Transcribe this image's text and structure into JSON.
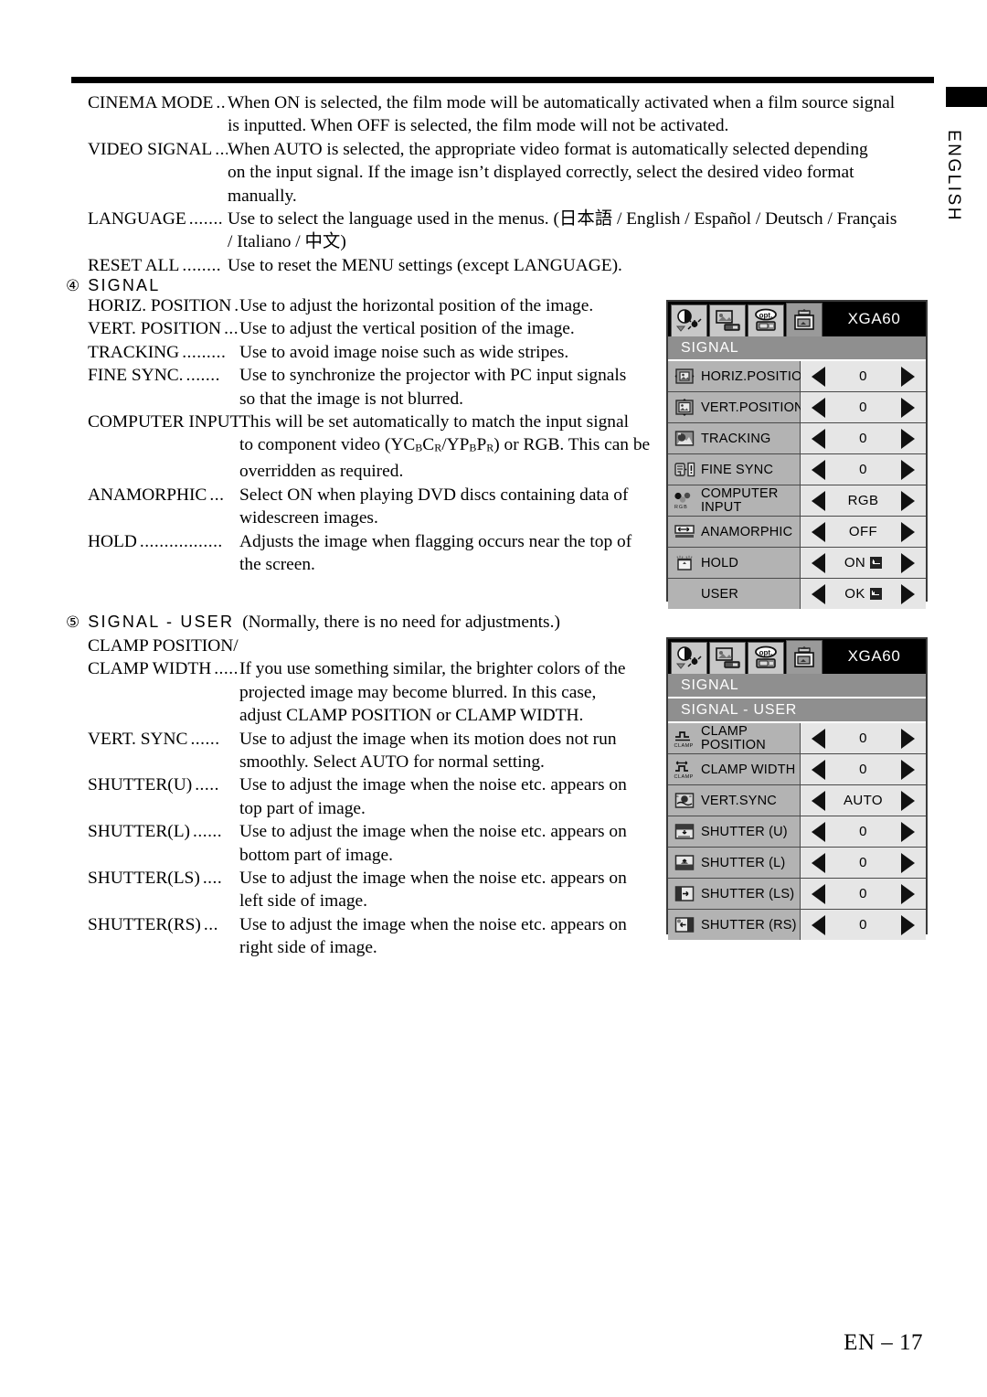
{
  "page": {
    "language_tab": "ENGLISH",
    "footer": "EN – 17"
  },
  "menu_descriptions": [
    {
      "term": "CINEMA MODE",
      "dots": "..",
      "lines": [
        "When ON is selected, the film mode will be automatically activated when a film source signal",
        "is inputted. When OFF is selected, the film mode will not be activated."
      ]
    },
    {
      "term": "VIDEO SIGNAL",
      "dots": "...",
      "lines": [
        "When AUTO is selected, the appropriate video format is automatically selected depending",
        "on the input signal. If the image isn’t displayed correctly, select the desired video format",
        "manually."
      ]
    },
    {
      "term": "LANGUAGE",
      "dots": ".......",
      "lines": [
        "Use to select the language used in the menus. (日本語 / English / Español / Deutsch / Français",
        "/ Italiano / 中文)"
      ]
    },
    {
      "term": "RESET ALL",
      "dots": "........",
      "lines": [
        "Use to reset the MENU settings (except LANGUAGE)."
      ]
    }
  ],
  "section_signal": {
    "number": "④",
    "heading": "SIGNAL",
    "items": [
      {
        "term": "HORIZ. POSITION",
        "dots": "....",
        "lines": [
          "Use to adjust the horizontal position of the image."
        ]
      },
      {
        "term": "VERT. POSITION",
        "dots": ".....",
        "lines": [
          "Use to adjust the vertical position of the image."
        ]
      },
      {
        "term": "TRACKING",
        "dots": ".........",
        "lines": [
          "Use to avoid image noise such as wide stripes."
        ]
      },
      {
        "term": "FINE SYNC.",
        "dots": ".......",
        "lines": [
          "Use to synchronize the projector with PC input signals",
          "so that the image is not blurred."
        ]
      },
      {
        "term": "COMPUTER INPUT",
        "dots": "......",
        "lines": [
          "This will be set automatically to match the input signal",
          "to component video (YCBCR/YPBPR) or RGB. This can be",
          "overridden as required."
        ]
      },
      {
        "term": "ANAMORPHIC",
        "dots": "...",
        "lines": [
          "Select ON when playing DVD discs containing data of",
          "widescreen images."
        ]
      },
      {
        "term": "HOLD",
        "dots": ".................",
        "lines": [
          "Adjusts the image when flagging occurs near the top of",
          "the screen."
        ]
      }
    ]
  },
  "section_signal_user": {
    "number": "⑤",
    "heading": "SIGNAL - USER",
    "note": "(Normally, there is no need for adjustments.)",
    "items": [
      {
        "term_line1": "CLAMP POSITION/",
        "term": "CLAMP WIDTH",
        "dots": ".........",
        "lines": [
          "If you use something similar, the brighter colors of the",
          "projected image may become blurred. In this case,",
          "adjust CLAMP POSITION or CLAMP WIDTH."
        ]
      },
      {
        "term": "VERT. SYNC",
        "dots": "......",
        "lines": [
          "Use to adjust the image when its motion does not run",
          "smoothly.  Select AUTO for normal setting."
        ]
      },
      {
        "term": "SHUTTER(U)",
        "dots": ".....",
        "lines": [
          "Use to adjust the image when the noise etc. appears on",
          "top part of image."
        ]
      },
      {
        "term": "SHUTTER(L)",
        "dots": "......",
        "lines": [
          "Use to adjust the image when the noise etc. appears on",
          "bottom part of image."
        ]
      },
      {
        "term": "SHUTTER(LS)",
        "dots": "....",
        "lines": [
          "Use to adjust the image when the noise etc. appears on",
          "left side of image."
        ]
      },
      {
        "term": "SHUTTER(RS)",
        "dots": "...",
        "lines": [
          "Use to adjust the image when the noise etc. appears on",
          "right side of image."
        ]
      }
    ]
  },
  "osd_signal": {
    "signal_label": "XGA60",
    "tabs": [
      "image-tab",
      "video-tab",
      "opt-tab",
      "signal-tab"
    ],
    "selected_tab": 3,
    "title": "SIGNAL",
    "rows": [
      {
        "icon": "horiz-position-icon",
        "label": "HORIZ.POSITION",
        "value": "0"
      },
      {
        "icon": "vert-position-icon",
        "label": "VERT.POSITION",
        "value": "0"
      },
      {
        "icon": "tracking-icon",
        "label": "TRACKING",
        "value": "0"
      },
      {
        "icon": "fine-sync-icon",
        "label": "FINE SYNC",
        "value": "0"
      },
      {
        "icon": "computer-input-icon",
        "label": "COMPUTER",
        "label2": "INPUT",
        "value": "RGB"
      },
      {
        "icon": "anamorphic-icon",
        "label": "ANAMORPHIC",
        "value": "OFF"
      },
      {
        "icon": "hold-icon",
        "label": "HOLD",
        "value": "ON",
        "enter": true
      },
      {
        "icon": "",
        "label": "USER",
        "value": "OK",
        "enter": true
      }
    ]
  },
  "osd_signal_user": {
    "signal_label": "XGA60",
    "tabs": [
      "image-tab",
      "video-tab",
      "opt-tab",
      "signal-tab"
    ],
    "selected_tab": 3,
    "title": "SIGNAL",
    "subtitle": "SIGNAL - USER",
    "rows": [
      {
        "icon": "clamp-position-icon",
        "label": "CLAMP",
        "label2": "POSITION",
        "value": "0"
      },
      {
        "icon": "clamp-width-icon",
        "label": "CLAMP WIDTH",
        "value": "0"
      },
      {
        "icon": "vert-sync-icon",
        "label": "VERT.SYNC",
        "value": "AUTO"
      },
      {
        "icon": "shutter-u-icon",
        "label": "SHUTTER (U)",
        "value": "0"
      },
      {
        "icon": "shutter-l-icon",
        "label": "SHUTTER (L)",
        "value": "0"
      },
      {
        "icon": "shutter-ls-icon",
        "label": "SHUTTER (LS)",
        "value": "0"
      },
      {
        "icon": "shutter-rs-icon",
        "label": "SHUTTER (RS)",
        "value": "0"
      }
    ]
  }
}
